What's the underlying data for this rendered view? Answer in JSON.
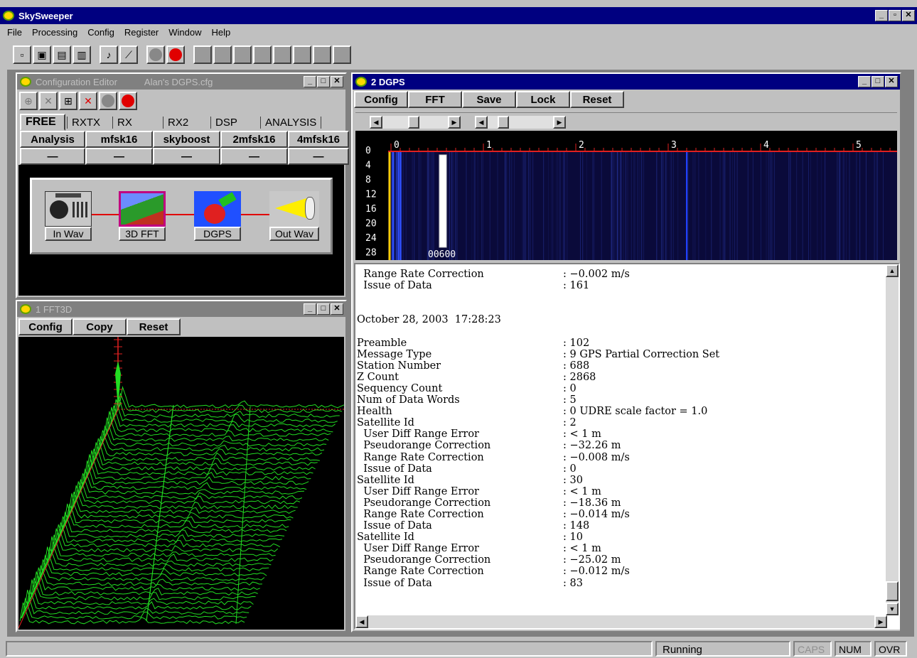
{
  "app": {
    "title": "SkySweeper"
  },
  "menu": [
    "File",
    "Processing",
    "Config",
    "Register",
    "Window",
    "Help"
  ],
  "config_editor": {
    "title": "Configuration Editor",
    "file": "Alan's DGPS.cfg",
    "tabs": [
      "FREE",
      "RXTX",
      "RX",
      "RX2",
      "DSP",
      "ANALYSIS"
    ],
    "subtabs": [
      "Analysis",
      "mfsk16",
      "skyboost",
      "2mfsk16",
      "4mfsk16"
    ],
    "slot_dash": "—",
    "chain": [
      {
        "label": "In Wav",
        "icon": "radio-icon"
      },
      {
        "label": "3D FFT",
        "icon": "spectrum-icon"
      },
      {
        "label": "DGPS",
        "icon": "satellite-icon"
      },
      {
        "label": "Out Wav",
        "icon": "speaker-icon"
      }
    ]
  },
  "fft3d": {
    "title": "1 FFT3D",
    "buttons": [
      "Config",
      "Copy",
      "Reset"
    ]
  },
  "dgps": {
    "title": "2 DGPS",
    "buttons": [
      "Config",
      "FFT",
      "Save",
      "Lock",
      "Reset"
    ],
    "spectrum": {
      "x_ticks": [
        "0",
        "1",
        "2",
        "3",
        "4",
        "5"
      ],
      "y_ticks": [
        "0",
        "4",
        "8",
        "12",
        "16",
        "20",
        "24",
        "28"
      ],
      "freq_label": "00600"
    },
    "lines": [
      {
        "key": "  Range Rate Correction",
        "value": ": −0.002 m/s"
      },
      {
        "key": "  Issue of Data",
        "value": ": 161"
      },
      {
        "key": "",
        "value": ""
      },
      {
        "key": "",
        "value": ""
      },
      {
        "key": "October 28, 2003  17:28:23",
        "value": ""
      },
      {
        "key": "",
        "value": ""
      },
      {
        "key": "Preamble",
        "value": ": 102"
      },
      {
        "key": "Message Type",
        "value": ": 9 GPS Partial Correction Set"
      },
      {
        "key": "Station Number",
        "value": ": 688"
      },
      {
        "key": "Z Count",
        "value": ": 2868"
      },
      {
        "key": "Sequency Count",
        "value": ": 0"
      },
      {
        "key": "Num of Data Words",
        "value": ": 5"
      },
      {
        "key": "Health",
        "value": ": 0 UDRE scale factor = 1.0"
      },
      {
        "key": "Satellite Id",
        "value": ": 2"
      },
      {
        "key": "  User Diff Range Error",
        "value": ": < 1 m"
      },
      {
        "key": "  Pseudorange Correction",
        "value": ": −32.26 m"
      },
      {
        "key": "  Range Rate Correction",
        "value": ": −0.008 m/s"
      },
      {
        "key": "  Issue of Data",
        "value": ": 0"
      },
      {
        "key": "Satellite Id",
        "value": ": 30"
      },
      {
        "key": "  User Diff Range Error",
        "value": ": < 1 m"
      },
      {
        "key": "  Pseudorange Correction",
        "value": ": −18.36 m"
      },
      {
        "key": "  Range Rate Correction",
        "value": ": −0.014 m/s"
      },
      {
        "key": "  Issue of Data",
        "value": ": 148"
      },
      {
        "key": "Satellite Id",
        "value": ": 10"
      },
      {
        "key": "  User Diff Range Error",
        "value": ": < 1 m"
      },
      {
        "key": "  Pseudorange Correction",
        "value": ": −25.02 m"
      },
      {
        "key": "  Range Rate Correction",
        "value": ": −0.012 m/s"
      },
      {
        "key": "  Issue of Data",
        "value": ": 83"
      }
    ]
  },
  "status": {
    "state": "Running",
    "caps": "CAPS",
    "num": "NUM",
    "ovr": "OVR"
  },
  "colors": {
    "title_active": "#000080",
    "spectrum_bg": "#0a0a3a",
    "waterfall": "#22dd22"
  }
}
